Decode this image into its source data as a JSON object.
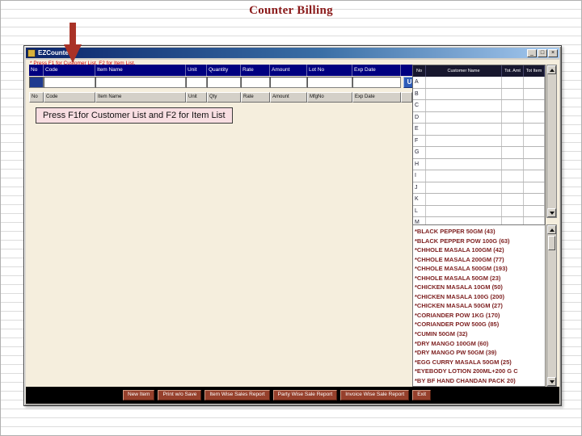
{
  "page": {
    "title": "Counter Billing"
  },
  "window": {
    "title": "EZCounter",
    "controls": {
      "minimize": "_",
      "maximize": "□",
      "close": "×"
    },
    "instruction": "* Press F1 for Customer List, F2 for Item List."
  },
  "entry": {
    "columns": [
      "No",
      "Code",
      "Item Name",
      "Unit",
      "Quantity",
      "Rate",
      "Amount",
      "Lot No",
      "Exp Date"
    ],
    "update_button": "U"
  },
  "grid": {
    "columns": [
      "No",
      "Code",
      "Item Name",
      "Unit",
      "Qty",
      "Rate",
      "Amount",
      "MfgNo",
      "Exp Date"
    ]
  },
  "tooltip": {
    "text": "Press F1for Customer List and F2 for Item List"
  },
  "customers": {
    "columns": [
      "No",
      "Customer Name",
      "Tot. Amt",
      "Tot Item"
    ],
    "rows": [
      "A",
      "B",
      "C",
      "D",
      "E",
      "F",
      "G",
      "H",
      "I",
      "J",
      "K",
      "L",
      "M"
    ]
  },
  "items": {
    "list": [
      "*BLACK PEPPER 50GM (43)",
      "*BLACK PEPPER POW 100G (63)",
      "*CHHOLE MASALA 100GM (42)",
      "*CHHOLE MASALA 200GM (77)",
      "*CHHOLE MASALA 500GM (193)",
      "*CHHOLE MASALA 50GM (23)",
      "*CHICKEN MASALA 10GM (50)",
      "*CHICKEN MASALA 100G (200)",
      "*CHICKEN MASALA 50GM (27)",
      "*CORIANDER POW 1KG (170)",
      "*CORIANDER POW 500G (85)",
      "*CUMIN 50GM (32)",
      "*DRY MANGO 100GM (60)",
      "*DRY MANGO PW 50GM (39)",
      "*EGG CURRY MASALA 50GM (25)",
      "*EYEBODY LOTION 200ML+200 G C",
      "*BY BF HAND CHANDAN PACK 20)"
    ]
  },
  "footer": {
    "buttons": [
      "New Item",
      "Print w/o Save",
      "Item Wise Sales Report",
      "Party Wise Sale Report",
      "Invoice Wise Sale Report",
      "Exit"
    ]
  },
  "colors": {
    "title_red": "#8b1a1a",
    "header_navy": "#000080",
    "footer_button_brown": "#96402c",
    "item_text_red": "#7d1f1f",
    "tooltip_pink": "#f8dee2"
  }
}
